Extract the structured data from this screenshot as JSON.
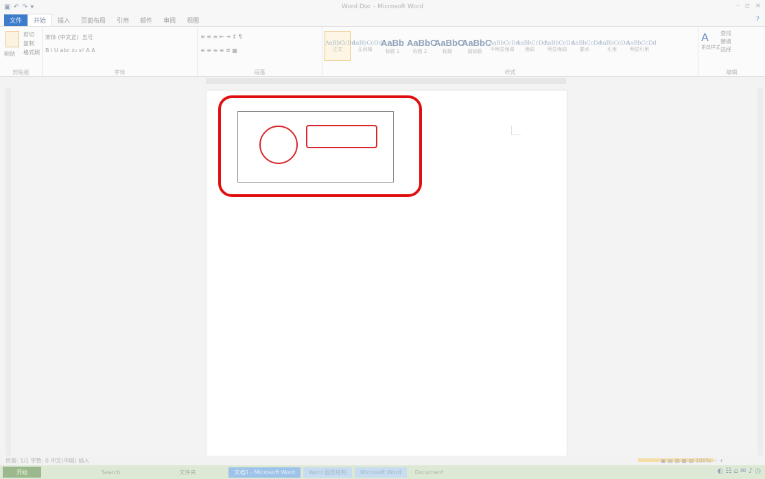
{
  "window": {
    "title": "Word Doc - Microsoft Word",
    "quick_access": [
      "▣",
      "↶",
      "↷",
      "▾"
    ],
    "controls": [
      "–",
      "▫",
      "×"
    ]
  },
  "tabs": [
    {
      "label": "文件"
    },
    {
      "label": "开始"
    },
    {
      "label": "插入"
    },
    {
      "label": "页面布局"
    },
    {
      "label": "引用"
    },
    {
      "label": "邮件"
    },
    {
      "label": "审阅"
    },
    {
      "label": "视图"
    }
  ],
  "help_icon": "?",
  "ribbon": {
    "clipboard": {
      "label": "剪贴板",
      "paste": "粘贴",
      "cut": "剪切",
      "copy": "复制",
      "format_painter": "格式刷"
    },
    "font": {
      "label": "字体",
      "name": "宋体 (中文正)",
      "size": "五号",
      "row2": "B  I  U  abc  x₂  x²  A  A"
    },
    "paragraph": {
      "label": "段落",
      "row1": "≡  ≡  ≡  ⇤  ⇥  ↕  ¶",
      "row2": "≡  ≡  ≡  ≡  ≣  ▦"
    },
    "styles": {
      "label": "样式",
      "items": [
        {
          "sample": "AaBbCcDd",
          "name": "正文"
        },
        {
          "sample": "AaBbCcDd",
          "name": "无间隔"
        },
        {
          "sample": "AaBb",
          "name": "标题 1"
        },
        {
          "sample": "AaBbC",
          "name": "标题 2"
        },
        {
          "sample": "AaBbC",
          "name": "标题"
        },
        {
          "sample": "AaBbC",
          "name": "副标题"
        },
        {
          "sample": "AaBbCcDd",
          "name": "不明显强调"
        },
        {
          "sample": "AaBbCcDd",
          "name": "强调"
        },
        {
          "sample": "AaBbCcDd",
          "name": "明显强调"
        },
        {
          "sample": "AaBbCcDd",
          "name": "要点"
        },
        {
          "sample": "AaBbCcDd",
          "name": "引用"
        },
        {
          "sample": "AaBbCcDd",
          "name": "明显引用"
        }
      ],
      "change_styles": "更改样式"
    },
    "editing": {
      "label": "编辑",
      "find": "查找",
      "replace": "替换",
      "select": "选择"
    }
  },
  "status": {
    "left": "页面: 1/1   字数: 0   中文(中国)   插入",
    "right": "▣ ▤ ▥ ▦ ▧  100%  −   +"
  },
  "taskbar": {
    "start": "开始",
    "tasks": [
      {
        "label": "Search"
      },
      {
        "label": "文件夹"
      },
      {
        "label": "文档1 - Microsoft Word"
      },
      {
        "label": "Word 图形绘制"
      },
      {
        "label": "Microsoft Word"
      },
      {
        "label": "Document"
      }
    ],
    "tray": "◐ ☷ ⌂ ✉  ♪  ◷"
  },
  "colors": {
    "shape_red": "#d9262a",
    "highlight_red": "#e01010",
    "file_tab": "#3d7ccb"
  }
}
